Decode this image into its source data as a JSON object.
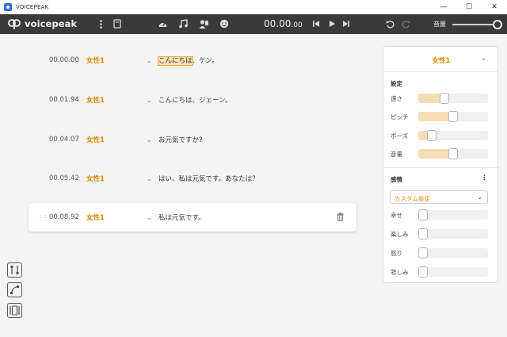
{
  "window": {
    "title": "VOICEPEAK",
    "minimize": "—",
    "maximize": "☐",
    "close": "✕"
  },
  "toolbar": {
    "logo_text": "voicepeak",
    "timecode_main": "00.00",
    "timecode_small": ".00",
    "volume_label": "音量"
  },
  "rows": [
    {
      "time": "00.00.00",
      "speaker": "女性1",
      "text_highlight": "こんにちは",
      "text_rest": "、ケン。"
    },
    {
      "time": "00.01.94",
      "speaker": "女性1",
      "text": "こんにちは、ジェーン。"
    },
    {
      "time": "00.04.07",
      "speaker": "女性1",
      "text": "お元気ですか？"
    },
    {
      "time": "00.05.42",
      "speaker": "女性1",
      "text": "はい、私は元気です。あなたは？"
    },
    {
      "time": "00.08.92",
      "speaker": "女性1",
      "text": "私は元気です。"
    }
  ],
  "panel": {
    "voice_name": "女性1",
    "settings_title": "設定",
    "params": [
      {
        "label": "速さ",
        "value": 0.35
      },
      {
        "label": "ピッチ",
        "value": 0.5
      },
      {
        "label": "ポーズ",
        "value": 0.14
      },
      {
        "label": "音量",
        "value": 0.5
      }
    ],
    "emotion_title": "感情",
    "emotion_menu": "⋮",
    "emotion_preset": "カスタム設定",
    "emotions": [
      {
        "label": "幸せ",
        "value": 0
      },
      {
        "label": "楽しみ",
        "value": 0
      },
      {
        "label": "怒り",
        "value": 0
      },
      {
        "label": "悲しみ",
        "value": 0
      }
    ]
  },
  "colors": {
    "accent": "#e08a00",
    "toolbar_bg": "#3a3a3a",
    "slider_fill": "#f8dcb5"
  }
}
